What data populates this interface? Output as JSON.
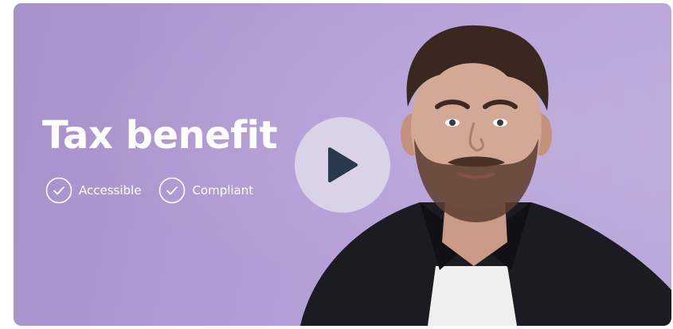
{
  "video": {
    "title": "Tax benefit",
    "features": [
      {
        "label": "Accessible",
        "icon": "check-circle-icon"
      },
      {
        "label": "Compliant",
        "icon": "check-circle-icon"
      }
    ],
    "play_icon": "play-icon"
  },
  "colors": {
    "background": "#b39dd6",
    "text": "#ffffff",
    "play_button_bg": "#dcd6e8",
    "play_icon": "#2a3a4d",
    "shirt": "#1b1b22",
    "undershirt": "#f2f2f2"
  }
}
